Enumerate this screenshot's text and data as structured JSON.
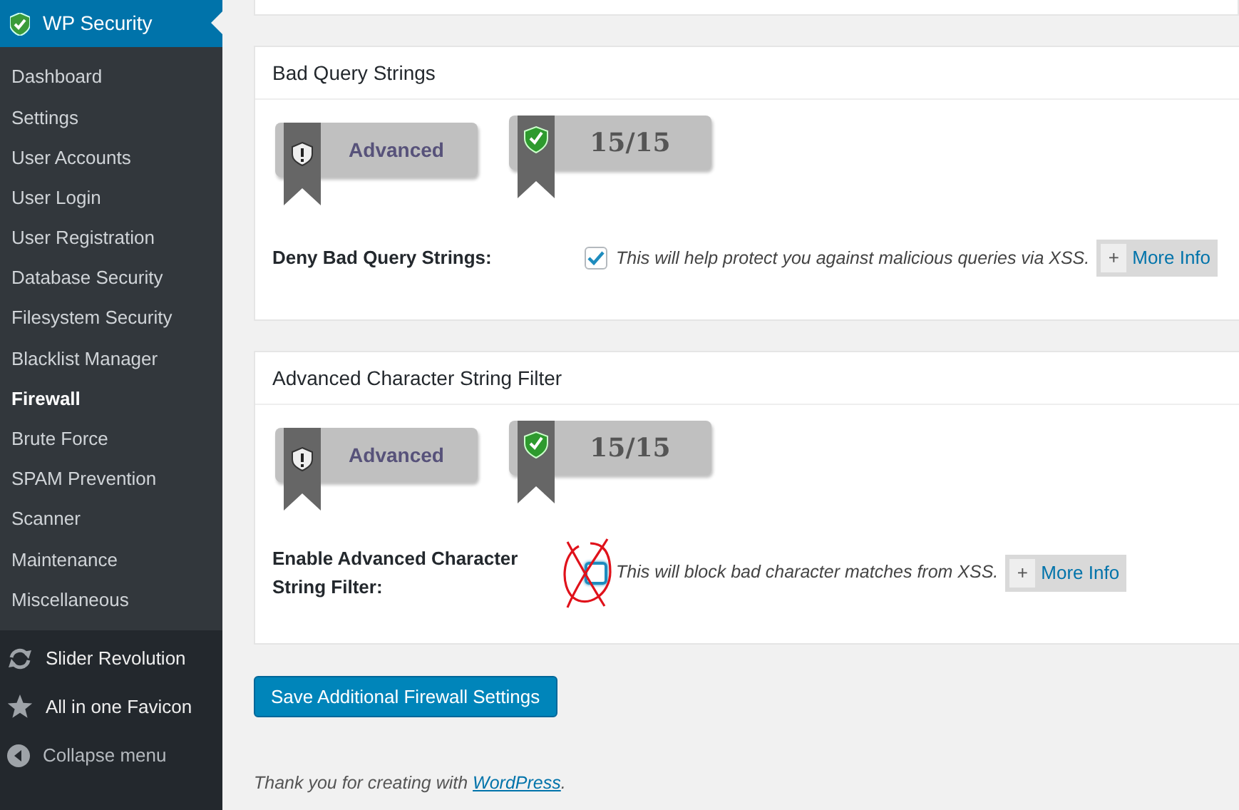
{
  "sidebar": {
    "header": "WP Security",
    "items": [
      {
        "label": "Dashboard",
        "selected": false
      },
      {
        "label": "Settings",
        "selected": false
      },
      {
        "label": "User Accounts",
        "selected": false
      },
      {
        "label": "User Login",
        "selected": false
      },
      {
        "label": "User Registration",
        "selected": false
      },
      {
        "label": "Database Security",
        "selected": false
      },
      {
        "label": "Filesystem Security",
        "selected": false
      },
      {
        "label": "Blacklist Manager",
        "selected": false
      },
      {
        "label": "Firewall",
        "selected": true
      },
      {
        "label": "Brute Force",
        "selected": false
      },
      {
        "label": "SPAM Prevention",
        "selected": false
      },
      {
        "label": "Scanner",
        "selected": false
      },
      {
        "label": "Maintenance",
        "selected": false
      },
      {
        "label": "Miscellaneous",
        "selected": false
      }
    ],
    "bottom_items": [
      {
        "label": "Slider Revolution",
        "kind": "refresh"
      },
      {
        "label": "All in one Favicon",
        "kind": "star"
      },
      {
        "label": "Collapse menu",
        "kind": "collapse"
      }
    ]
  },
  "sections": [
    {
      "title": "Bad Query Strings",
      "badges": [
        {
          "kind": "level",
          "text": "Advanced"
        },
        {
          "kind": "score",
          "text": "15/15"
        }
      ],
      "setting": {
        "label": "Deny Bad Query Strings:",
        "checked": true,
        "crossed_out": false,
        "description": "This will help protect you against malicious queries via XSS.",
        "more_sign": "+",
        "more_label": "More Info"
      }
    },
    {
      "title": "Advanced Character String Filter",
      "badges": [
        {
          "kind": "level",
          "text": "Advanced"
        },
        {
          "kind": "score",
          "text": "15/15"
        }
      ],
      "setting": {
        "label": "Enable Advanced Character String Filter:",
        "checked": false,
        "crossed_out": true,
        "description": "This will block bad character matches from XSS.",
        "more_sign": "+",
        "more_label": "More Info"
      }
    }
  ],
  "save_button": "Save Additional Firewall Settings",
  "footer": {
    "text": "Thank you for creating with ",
    "link": "WordPress",
    "after": "."
  }
}
